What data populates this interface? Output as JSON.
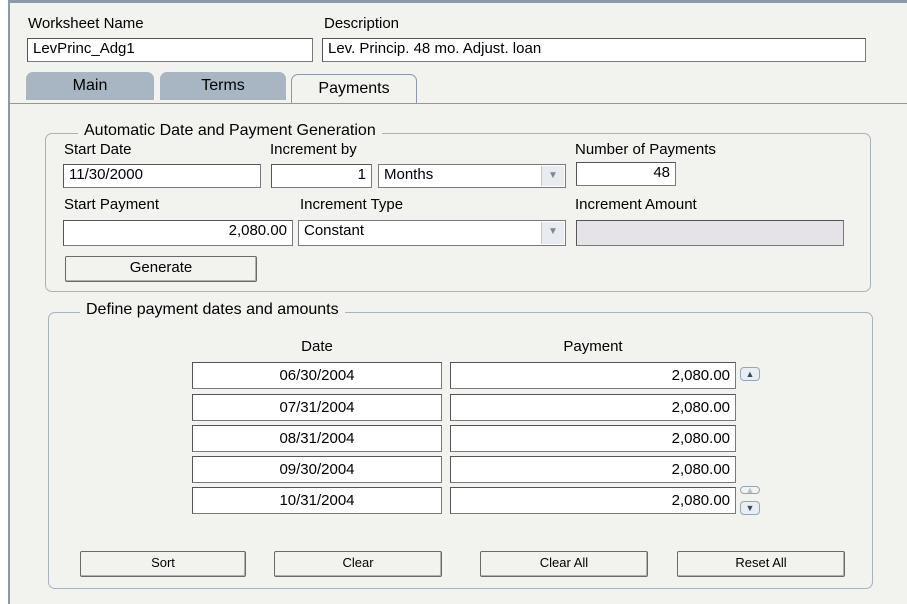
{
  "header": {
    "worksheet_name_label": "Worksheet Name",
    "worksheet_name_value": "LevPrinc_Adg1",
    "description_label": "Description",
    "description_value": "Lev. Princip. 48 mo. Adjust. loan"
  },
  "tabs": [
    {
      "label": "Main",
      "active": false
    },
    {
      "label": "Terms",
      "active": false
    },
    {
      "label": "Payments",
      "active": true
    }
  ],
  "auto_gen": {
    "title": "Automatic Date and Payment Generation",
    "start_date_label": "Start Date",
    "start_date_value": "11/30/2000",
    "increment_by_label": "Increment by",
    "increment_by_value": "1",
    "increment_unit": "Months",
    "num_payments_label": "Number of Payments",
    "num_payments_value": "48",
    "start_payment_label": "Start Payment",
    "start_payment_value": "2,080.00",
    "increment_type_label": "Increment Type",
    "increment_type_value": "Constant",
    "increment_amount_label": "Increment Amount",
    "increment_amount_value": "",
    "generate_label": "Generate"
  },
  "define": {
    "title": "Define payment dates and amounts",
    "date_header": "Date",
    "payment_header": "Payment",
    "rows": [
      {
        "date": "06/30/2004",
        "payment": "2,080.00"
      },
      {
        "date": "07/31/2004",
        "payment": "2,080.00"
      },
      {
        "date": "08/31/2004",
        "payment": "2,080.00"
      },
      {
        "date": "09/30/2004",
        "payment": "2,080.00"
      },
      {
        "date": "10/31/2004",
        "payment": "2,080.00"
      }
    ]
  },
  "buttons": {
    "sort": "Sort",
    "clear": "Clear",
    "clear_all": "Clear All",
    "reset_all": "Reset All"
  }
}
